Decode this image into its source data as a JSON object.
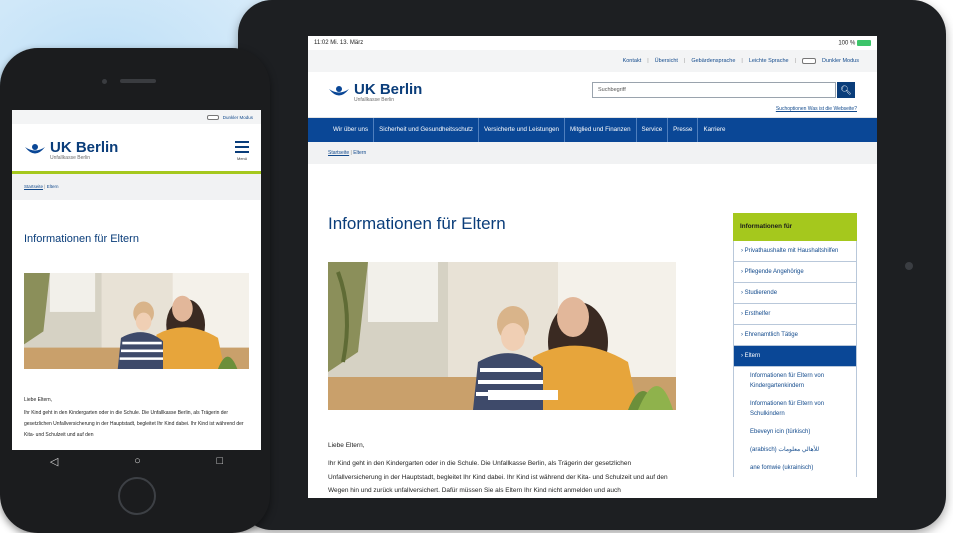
{
  "tablet": {
    "status": {
      "time": "11:02  Mi. 13. März",
      "battery": "100 %"
    },
    "top_links": [
      "Kontakt",
      "Übersicht",
      "Gebärdensprache",
      "Leichte Sprache",
      "Dunkler Modus"
    ],
    "logo": {
      "name": "UK Berlin",
      "sub": "Unfallkasse Berlin"
    },
    "search": {
      "placeholder": "Suchbegriff",
      "links": "Suchoptionen   Was ist die Webseite?"
    },
    "nav": [
      "Wir über uns",
      "Sicherheit und Gesundheitsschutz",
      "Versicherte und Leistungen",
      "Mitglied und Finanzen",
      "Service",
      "Presse",
      "Karriere"
    ],
    "breadcrumb": {
      "home": "Startseite",
      "current": "Eltern"
    },
    "title": "Informationen für Eltern",
    "greeting": "Liebe Eltern,",
    "paragraph": "Ihr Kind geht in den Kindergarten oder in die Schule. Die Unfallkasse Berlin, als Trägerin der gesetzlichen Unfallversicherung in der Hauptstadt, begleitet Ihr Kind dabei. Ihr Kind ist während der Kita- und Schulzeit und auf den Wegen hin und zurück unfallversichert. Dafür müssen Sie als Eltern Ihr Kind nicht anmelden und auch",
    "sidebar": {
      "heading": "Informationen für",
      "items": [
        "Privathaushalte mit Haushaltshilfen",
        "Pflegende Angehörige",
        "Studierende",
        "Ersthelfer",
        "Ehrenamtlich Tätige",
        "Eltern"
      ],
      "subitems": [
        "Informationen für Eltern von Kindergartenkindern",
        "Informationen für Eltern von Schulkindern",
        "Ebeveyn icin (türkisch)",
        "(arabisch) للأهالي معلومات",
        "ane fomwie (ukrainisch)"
      ]
    }
  },
  "phone": {
    "top_link": "Dunkler Modus",
    "logo": {
      "name": "UK Berlin",
      "sub": "Unfallkasse Berlin"
    },
    "menu_label": "Menü",
    "breadcrumb": {
      "home": "Startseite",
      "current": "Eltern"
    },
    "title": "Informationen für Eltern",
    "greeting": "Liebe Eltern,",
    "paragraph": "Ihr Kind geht in den Kindergarten oder in die Schule. Die Unfallkasse Berlin, als Trägerin der gesetzlichen Unfallversicherung in der Hauptstadt, begleitet Ihr Kind dabei. Ihr Kind ist während der Kita- und Schulzeit und auf den",
    "nav_buttons": [
      "◁",
      "○",
      "□"
    ]
  },
  "colors": {
    "brand_blue": "#0a4796",
    "lime": "#a5c81d"
  }
}
